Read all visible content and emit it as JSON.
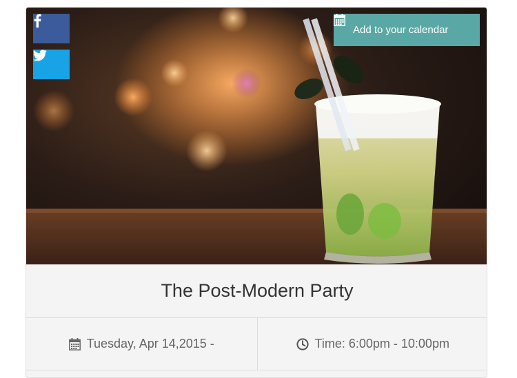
{
  "colors": {
    "facebook": "#3b5b9a",
    "twitter": "#17a3e6",
    "calendar_button": "#5aa8a5"
  },
  "hero": {
    "image": "cocktail-photo",
    "social": {
      "facebook_icon": "facebook-icon",
      "twitter_icon": "twitter-icon"
    },
    "calendar": {
      "icon": "calendar-icon",
      "label": "Add to your calendar"
    }
  },
  "event": {
    "title": "The Post-Modern Party",
    "date_icon": "calendar-icon",
    "date": "Tuesday, Apr 14,2015 -",
    "time_icon": "clock-icon",
    "time": "Time: 6:00pm - 10:00pm"
  }
}
